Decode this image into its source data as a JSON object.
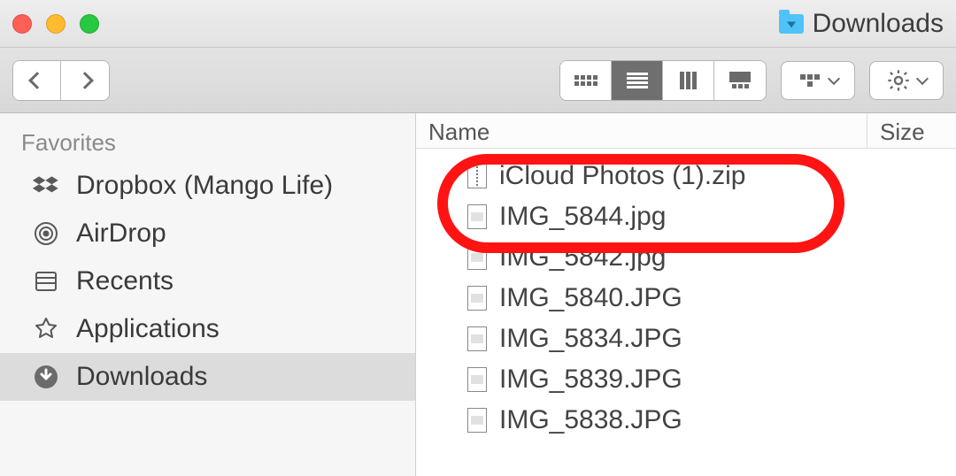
{
  "window": {
    "title": "Downloads"
  },
  "sidebar": {
    "heading": "Favorites",
    "items": [
      {
        "label": "Dropbox (Mango Life)",
        "icon": "dropbox",
        "selected": false
      },
      {
        "label": "AirDrop",
        "icon": "airdrop",
        "selected": false
      },
      {
        "label": "Recents",
        "icon": "recents",
        "selected": false
      },
      {
        "label": "Applications",
        "icon": "applications",
        "selected": false
      },
      {
        "label": "Downloads",
        "icon": "downloads",
        "selected": true
      }
    ]
  },
  "columns": {
    "name": "Name",
    "size": "Size"
  },
  "files": [
    {
      "name": "iCloud Photos (1).zip",
      "kind": "zip",
      "highlighted": true
    },
    {
      "name": "IMG_5844.jpg",
      "kind": "img",
      "highlighted": true
    },
    {
      "name": "IMG_5842.jpg",
      "kind": "img"
    },
    {
      "name": "IMG_5840.JPG",
      "kind": "img"
    },
    {
      "name": "IMG_5834.JPG",
      "kind": "img"
    },
    {
      "name": "IMG_5839.JPG",
      "kind": "img"
    },
    {
      "name": "IMG_5838.JPG",
      "kind": "img"
    }
  ]
}
